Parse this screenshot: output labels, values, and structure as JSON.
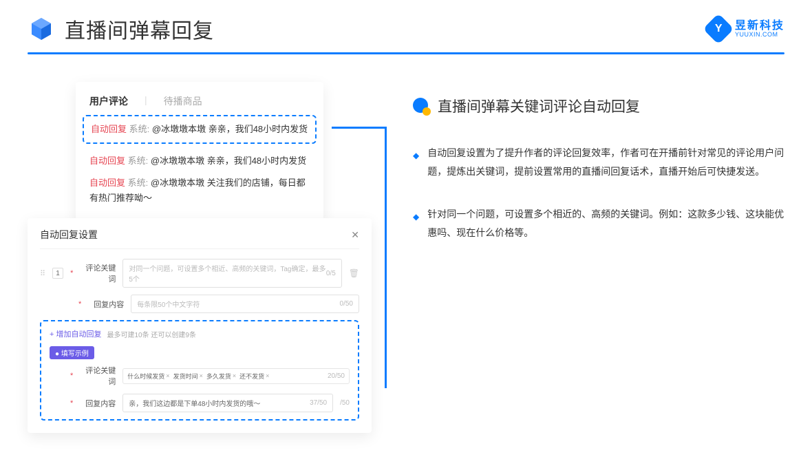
{
  "header": {
    "title": "直播间弹幕回复",
    "logo_cn": "昱新科技",
    "logo_en": "YUUXIN.COM",
    "logo_letter": "Y"
  },
  "comments": {
    "tab_active": "用户评论",
    "tab_inactive": "待播商品",
    "items": [
      {
        "tag": "自动回复",
        "sys": "系统:",
        "text": "@冰墩墩本墩 亲亲，我们48小时内发货"
      },
      {
        "tag": "自动回复",
        "sys": "系统:",
        "text": "@冰墩墩本墩 亲亲，我们48小时内发货"
      },
      {
        "tag": "自动回复",
        "sys": "系统:",
        "text": "@冰墩墩本墩 关注我们的店铺，每日都有热门推荐呦～"
      }
    ]
  },
  "settings": {
    "title": "自动回复设置",
    "index": "1",
    "keyword_label": "评论关键词",
    "keyword_placeholder": "对同一个问题，可设置多个相近、高频的关键词，Tag确定，最多5个",
    "keyword_count": "0/5",
    "content_label": "回复内容",
    "content_placeholder": "每条限50个中文字符",
    "content_count": "0/50",
    "add_link": "+ 增加自动回复",
    "add_sub": "最多可建10条 还可以创建9条",
    "example_badge": "● 填写示例",
    "ex_keyword_label": "评论关键词",
    "ex_tags": [
      "什么时候发货",
      "发货时间",
      "多久发货",
      "还不发货"
    ],
    "ex_keyword_count": "20/50",
    "ex_content_label": "回复内容",
    "ex_content": "亲，我们这边都是下单48小时内发货的哦～",
    "ex_content_count": "37/50",
    "content_count2": "/50"
  },
  "right": {
    "section_title": "直播间弹幕关键词评论自动回复",
    "bullets": [
      "自动回复设置为了提升作者的评论回复效率，作者可在开播前针对常见的评论用户问题，提炼出关键词，提前设置常用的直播间回复话术，直播开始后可快捷发送。",
      "针对同一个问题，可设置多个相近的、高频的关键词。例如：这款多少钱、这块能优惠吗、现在什么价格等。"
    ]
  }
}
